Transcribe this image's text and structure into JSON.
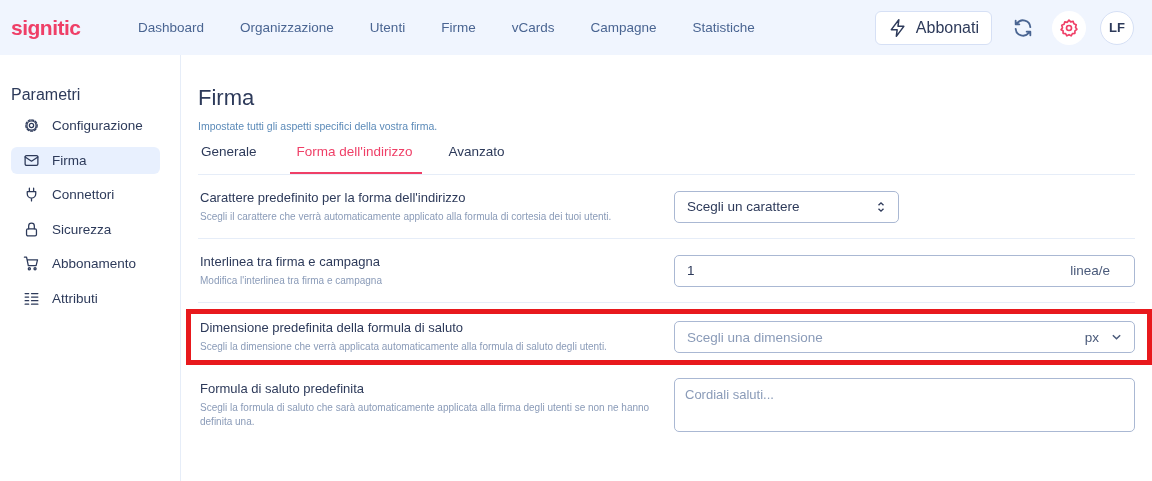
{
  "header": {
    "logo": "signitic",
    "nav": [
      {
        "label": "Dashboard"
      },
      {
        "label": "Organizzazione"
      },
      {
        "label": "Utenti"
      },
      {
        "label": "Firme"
      },
      {
        "label": "vCards"
      },
      {
        "label": "Campagne"
      },
      {
        "label": "Statistiche"
      }
    ],
    "subscribe_button": "Abbonati",
    "avatar": "LF"
  },
  "sidebar": {
    "title": "Parametri",
    "items": [
      {
        "label": "Configurazione",
        "selected": false
      },
      {
        "label": "Firma",
        "selected": true
      },
      {
        "label": "Connettori",
        "selected": false
      },
      {
        "label": "Sicurezza",
        "selected": false
      },
      {
        "label": "Abbonamento",
        "selected": false
      },
      {
        "label": "Attributi",
        "selected": false
      }
    ]
  },
  "page": {
    "title": "Firma",
    "subtitle": "Impostate tutti gli aspetti specifici della vostra firma.",
    "tabs": [
      {
        "label": "Generale",
        "selected": false
      },
      {
        "label": "Forma dell'indirizzo",
        "selected": true
      },
      {
        "label": "Avanzato",
        "selected": false
      }
    ],
    "settings": [
      {
        "title": "Carattere predefinito per la forma dell'indirizzo",
        "description": "Scegli il carattere che verrà automaticamente applicato alla formula di cortesia dei tuoi utenti.",
        "kind": "select",
        "value": "Scegli un carattere",
        "highlighted": false
      },
      {
        "title": "Interlinea tra firma e campagna",
        "description": "Modifica l'interlinea tra firma e campagna",
        "kind": "number",
        "value": "1",
        "unit": "linea/e",
        "highlighted": false
      },
      {
        "title": "Dimensione predefinita della formula di saluto",
        "description": "Scegli la dimensione che verrà applicata automaticamente alla formula di saluto degli utenti.",
        "kind": "unitselect",
        "placeholder": "Scegli una dimensione",
        "unit": "px",
        "highlighted": true
      },
      {
        "title": "Formula di saluto predefinita",
        "description": "Scegli la formula di saluto che sarà automaticamente applicata alla firma degli utenti se non ne hanno definita una.",
        "kind": "textarea",
        "placeholder": "Cordiali saluti...",
        "highlighted": false
      }
    ]
  }
}
